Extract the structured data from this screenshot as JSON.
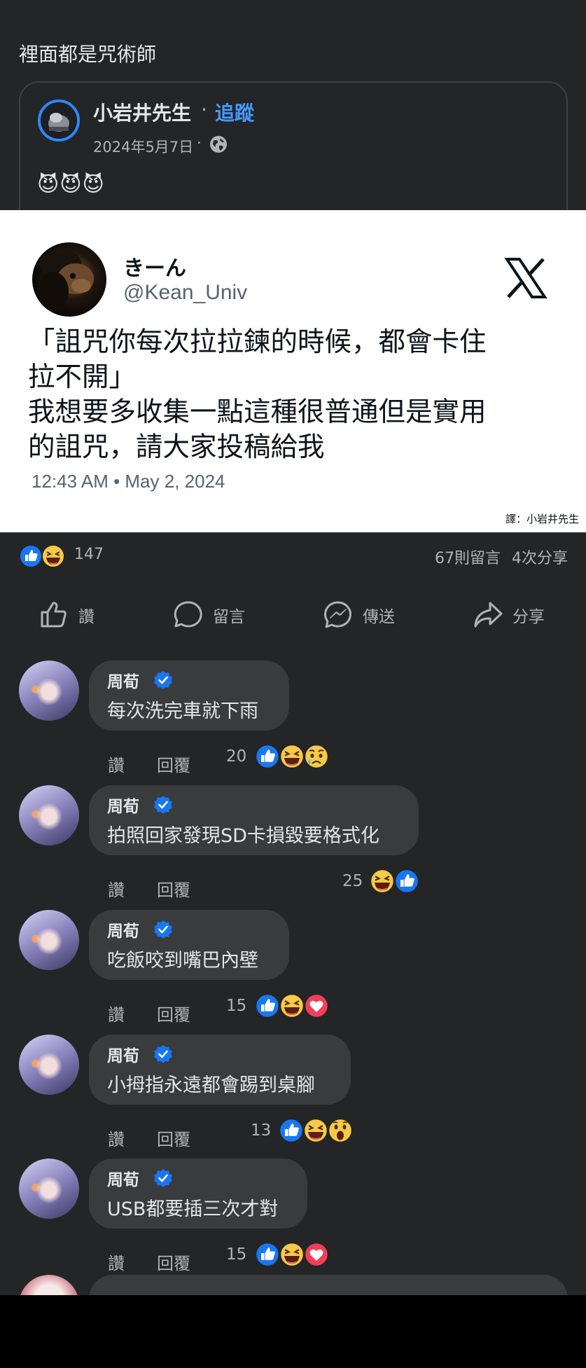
{
  "caption": "裡面都是咒術師",
  "shared_post": {
    "author": "小岩井先生",
    "follow_label": "追蹤",
    "date": "2024年5月7日",
    "emojis": "😈😈😈"
  },
  "tweet": {
    "display_name": "きーん",
    "handle": "@Kean_Univ",
    "text": "「詛咒你每次拉拉鍊的時候，都會卡住\n拉不開」\n我想要多收集一點這種很普通但是實用\n的詛咒，請大家投稿給我",
    "timestamp": "12:43 AM • May 2, 2024",
    "credit": "譯：小岩井先生"
  },
  "reactions": {
    "count": "147",
    "comments": "67則留言",
    "shares": "4次分享"
  },
  "actions": {
    "like": "讚",
    "comment": "留言",
    "send": "傳送",
    "share": "分享"
  },
  "comments": [
    {
      "name": "周荀",
      "text": "每次洗完車就下雨",
      "like": "讚",
      "reply": "回覆",
      "count": "20",
      "reactions": [
        "like",
        "haha",
        "sad"
      ]
    },
    {
      "name": "周荀",
      "text": "拍照回家發現SD卡損毀要格式化",
      "like": "讚",
      "reply": "回覆",
      "count": "25",
      "reactions": [
        "haha",
        "like"
      ]
    },
    {
      "name": "周荀",
      "text": "吃飯咬到嘴巴內壁",
      "like": "讚",
      "reply": "回覆",
      "count": "15",
      "reactions": [
        "like",
        "haha",
        "love"
      ]
    },
    {
      "name": "周荀",
      "text": "小拇指永遠都會踢到桌腳",
      "like": "讚",
      "reply": "回覆",
      "count": "13",
      "reactions": [
        "like",
        "haha",
        "wow"
      ]
    },
    {
      "name": "周荀",
      "text": "USB都要插三次才對",
      "like": "讚",
      "reply": "回覆",
      "count": "15",
      "reactions": [
        "like",
        "haha",
        "love"
      ]
    }
  ],
  "colors": {
    "background": "#242526",
    "bubble": "#3a3b3c",
    "accent": "#2d88ff",
    "follow": "#4599ff",
    "secondary_text": "#b0b3b8"
  }
}
